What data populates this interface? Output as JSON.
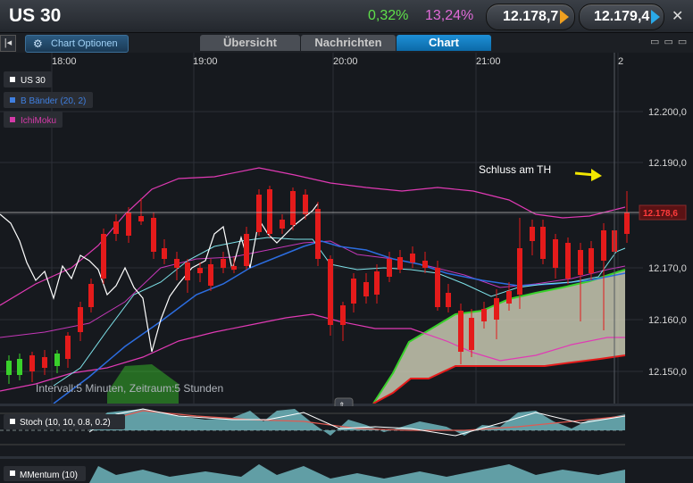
{
  "header": {
    "title": "US 30",
    "change_abs": "0,32%",
    "change_pct": "13,24%",
    "sell_price": "12.178,7",
    "buy_price": "12.179,4",
    "close_glyph": "✕"
  },
  "toolbar": {
    "back_glyph": "|◂",
    "chart_options": "Chart Optionen",
    "tabs": [
      "Übersicht",
      "Nachrichten",
      "Chart"
    ],
    "active_tab": "Chart",
    "window_controls": "▭ ▭ ▭"
  },
  "time_axis": [
    "18:00",
    "19:00",
    "20:00",
    "21:00",
    "2"
  ],
  "price_axis": [
    "12.200,0",
    "12.190,0",
    "12.180,0",
    "12.170,0",
    "12.160,0",
    "12.150,0"
  ],
  "current_price_tag": "12.178,6",
  "legend": [
    {
      "label": "US 30",
      "color": "#ffffff"
    },
    {
      "label": "B Bänder (20, 2)",
      "color": "#3f7fe0"
    },
    {
      "label": "IchiMoku",
      "color": "#d43aa8"
    }
  ],
  "annotation": "Schluss am TH",
  "interval_text": "Intervall:5 Minuten, Zeitraum:5 Stunden",
  "sub_panels": [
    {
      "label": "Stoch (10, 10, 0.8, 0.2)"
    },
    {
      "label": "MMentum (10)"
    }
  ],
  "colors": {
    "up": "#39d12b",
    "down": "#e41b1b",
    "bollinger": "#e03ab4",
    "ichimoku_cloud": "#d9d8bf",
    "accent": "#1e8fd6"
  }
}
